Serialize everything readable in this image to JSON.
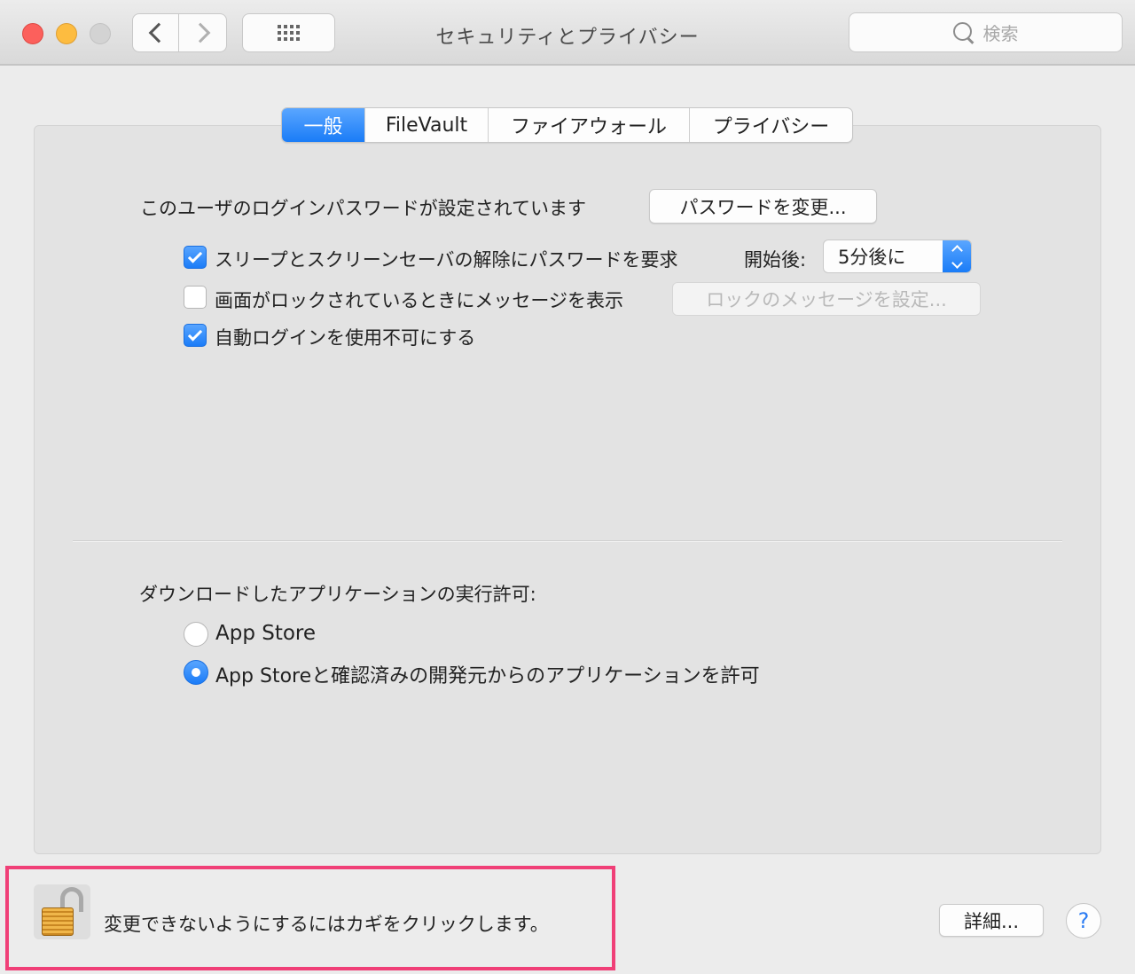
{
  "window": {
    "title": "セキュリティとプライバシー",
    "search_placeholder": "検索"
  },
  "tabs": [
    {
      "label": "一般",
      "active": true
    },
    {
      "label": "FileVault",
      "active": false
    },
    {
      "label": "ファイアウォール",
      "active": false
    },
    {
      "label": "プライバシー",
      "active": false
    }
  ],
  "general": {
    "password_status": "このユーザのログインパスワードが設定されています",
    "change_password_label": "パスワードを変更...",
    "require_password": {
      "label": "スリープとスクリーンセーバの解除にパスワードを要求",
      "checked": true
    },
    "after_label": "開始後:",
    "after_value": "5分後に",
    "lock_message": {
      "label": "画面がロックされているときにメッセージを表示",
      "checked": false
    },
    "set_lock_message_label": "ロックのメッセージを設定...",
    "disable_auto_login": {
      "label": "自動ログインを使用不可にする",
      "checked": true
    }
  },
  "downloads": {
    "heading": "ダウンロードしたアプリケーションの実行許可:",
    "options": [
      {
        "label": "App Store",
        "selected": false
      },
      {
        "label": "App Storeと確認済みの開発元からのアプリケーションを許可",
        "selected": true
      }
    ]
  },
  "footer": {
    "lock_text": "変更できないようにするにはカギをクリックします。",
    "advanced_label": "詳細...",
    "help_label": "?"
  },
  "colors": {
    "accent": "#1a7cf7",
    "highlight": "#f03f77"
  }
}
